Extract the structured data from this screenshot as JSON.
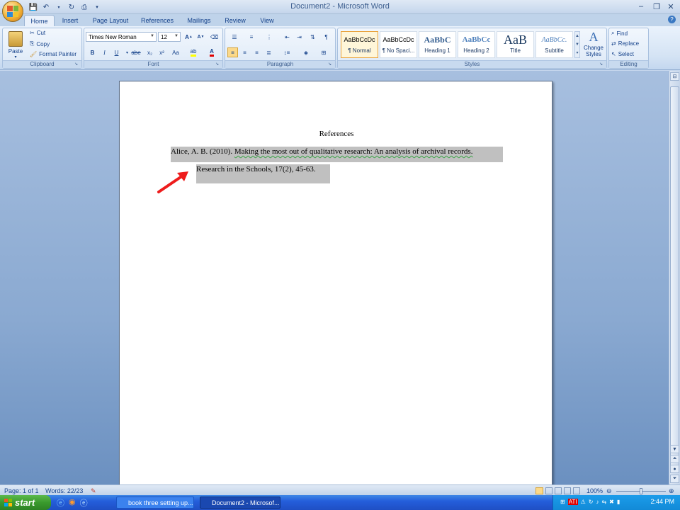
{
  "window": {
    "title": "Document2 - Microsoft Word",
    "controls": {
      "minimize": "–",
      "restore": "❐",
      "close": "✕"
    }
  },
  "tabs": [
    {
      "label": "Home",
      "active": true
    },
    {
      "label": "Insert"
    },
    {
      "label": "Page Layout"
    },
    {
      "label": "References"
    },
    {
      "label": "Mailings"
    },
    {
      "label": "Review"
    },
    {
      "label": "View"
    }
  ],
  "clipboard": {
    "paste": "Paste",
    "cut": "Cut",
    "copy": "Copy",
    "format_painter": "Format Painter",
    "group_label": "Clipboard"
  },
  "font": {
    "font_name": "Times New Roman",
    "font_size": "12",
    "group_label": "Font",
    "bold": "B",
    "italic": "I",
    "underline": "U",
    "strike": "abe",
    "subscript": "x₂",
    "superscript": "x²",
    "change_case": "Aa"
  },
  "paragraph": {
    "group_label": "Paragraph"
  },
  "styles": {
    "group_label": "Styles",
    "items": [
      {
        "sample": "AaBbCcDc",
        "name": "¶ Normal",
        "active": true
      },
      {
        "sample": "AaBbCcDc",
        "name": "¶ No Spaci..."
      },
      {
        "sample": "AaBbC",
        "name": "Heading 1"
      },
      {
        "sample": "AaBbCc",
        "name": "Heading 2"
      },
      {
        "sample": "AaB",
        "name": "Title"
      },
      {
        "sample": "AaBbCc.",
        "name": "Subtitle"
      }
    ],
    "change_styles": "Change Styles"
  },
  "editing": {
    "find": "Find",
    "replace": "Replace",
    "select": "Select",
    "group_label": "Editing"
  },
  "document": {
    "heading": "References",
    "ref_prefix": "Alice, A. B. (2010). ",
    "ref_title": "Making the most out of qualitative research:  An analysis of archival records.",
    "ref_line2": "Research in the Schools, 17(2), 45-63."
  },
  "statusbar": {
    "page": "Page: 1 of 1",
    "words": "Words: 22/23",
    "zoom": "100%"
  },
  "taskbar": {
    "start": "start",
    "tasks": [
      {
        "label": "book three setting up..."
      },
      {
        "label": "Document2 - Microsof...",
        "active": true
      }
    ],
    "clock": "2:44 PM"
  }
}
